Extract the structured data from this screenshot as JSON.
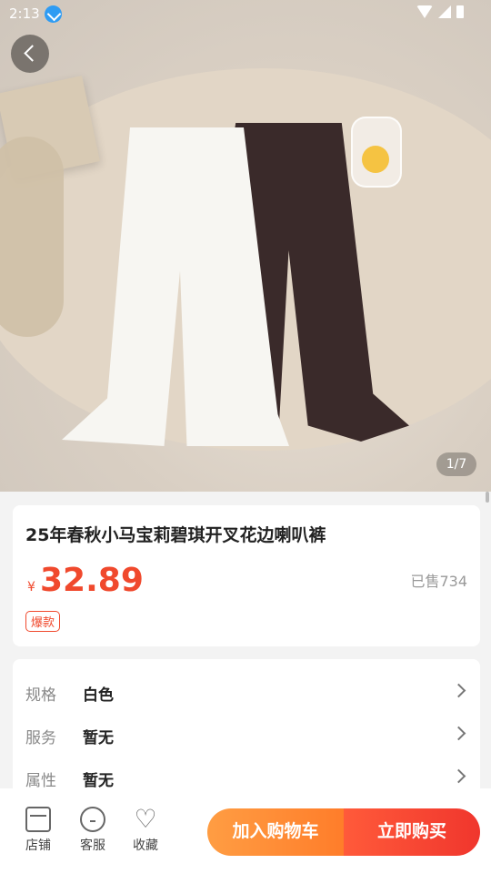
{
  "status_bar": {
    "time": "2:13"
  },
  "gallery": {
    "indicator": "1/7"
  },
  "product": {
    "title": "25年春秋小马宝莉碧琪开叉花边喇叭裤",
    "currency": "¥",
    "price": "32.89",
    "sold": "已售734",
    "badge": "爆款"
  },
  "specs": [
    {
      "label": "规格",
      "value": "白色"
    },
    {
      "label": "服务",
      "value": "暂无"
    },
    {
      "label": "属性",
      "value": "暂无"
    }
  ],
  "bottom_bar": {
    "store": "店铺",
    "service": "客服",
    "favorite": "收藏",
    "add_to_cart": "加入购物车",
    "buy_now": "立即购买"
  },
  "colors": {
    "accent": "#f0492d",
    "cart_orange": "#ff8a33"
  },
  "icons": [
    "back-icon",
    "download-icon",
    "wifi-icon",
    "signal-icon",
    "battery-icon",
    "store-icon",
    "headset-icon",
    "heart-icon",
    "chevron-right-icon"
  ]
}
